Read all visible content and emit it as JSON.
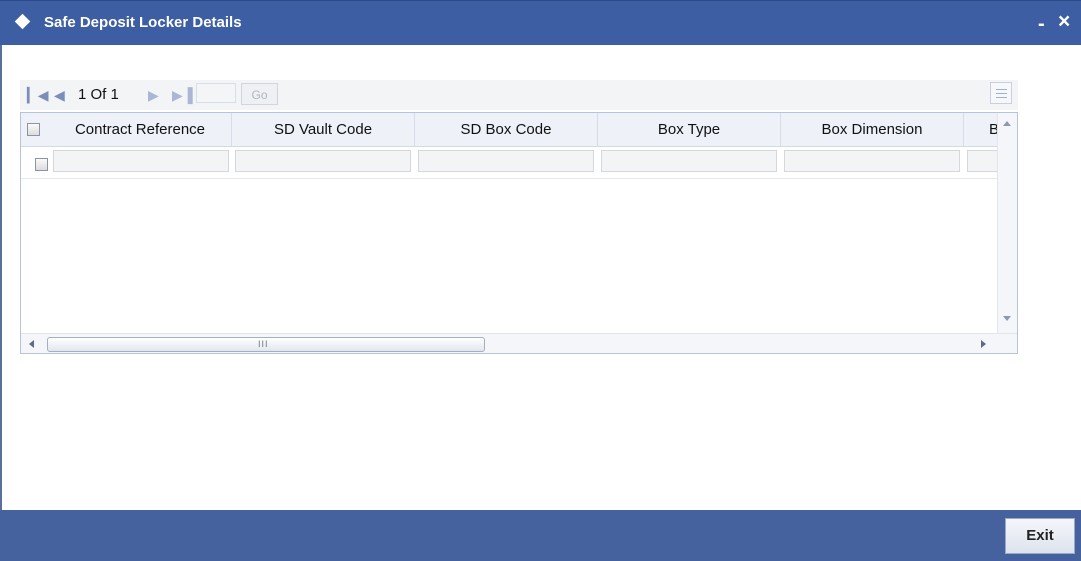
{
  "window": {
    "title": "Safe Deposit Locker Details",
    "minimize_label": "-",
    "close_label": "×"
  },
  "pager": {
    "first_icon": "first-page-icon",
    "prev_icon": "prev-page-icon",
    "page_text": "1 Of 1",
    "next_icon": "next-page-icon",
    "last_icon": "last-page-icon",
    "page_input_value": "",
    "go_label": "Go",
    "layout_icon": "grid-settings-icon"
  },
  "grid": {
    "columns": [
      "Contract Reference",
      "SD Vault Code",
      "SD Box Code",
      "Box Type",
      "Box Dimension",
      "B"
    ],
    "rows": [
      [
        "",
        "",
        "",
        "",
        "",
        ""
      ]
    ],
    "hscroll_grip": "III"
  },
  "footer": {
    "exit_label": "Exit"
  },
  "colors": {
    "titlebar": "#3e5ea4",
    "footer": "#45629f",
    "header_bg": "#eef2f8"
  }
}
